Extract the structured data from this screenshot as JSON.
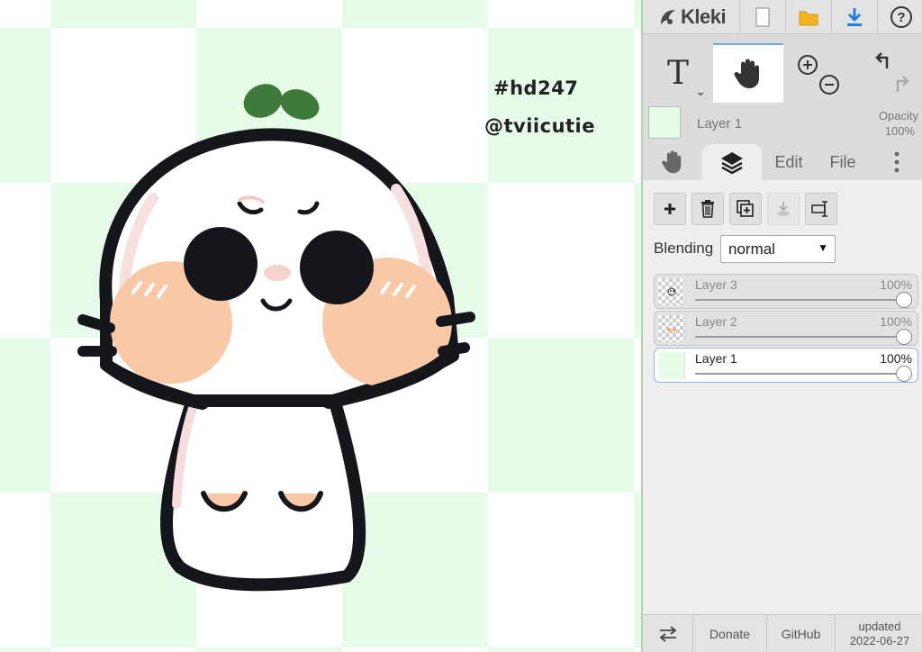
{
  "canvas": {
    "watermark_line1": "#hd247",
    "watermark_line2": "@tviicutie",
    "colors": {
      "checker_green": "#e6fbe8",
      "outline": "#14161c",
      "cheek": "#f9c9a7",
      "leaf": "#3f7a3a",
      "nose": "#f4d3cf"
    }
  },
  "topbar": {
    "app_name": "Kleki",
    "icons": [
      "kleki-logo-icon",
      "new-document-icon",
      "open-folder-icon",
      "download-icon",
      "help-icon"
    ]
  },
  "tools": {
    "text_tool_glyph": "T",
    "caret": "⌄",
    "active_tool": "hand-tool",
    "icons": [
      "text-tool-icon",
      "hand-tool-icon",
      "zoom-in-icon",
      "zoom-out-icon",
      "undo-icon",
      "redo-icon"
    ]
  },
  "layer_info": {
    "name": "Layer 1",
    "opacity_label": "Opacity",
    "opacity_value": "100%"
  },
  "tabs": {
    "edit": "Edit",
    "file": "File",
    "active": "layers"
  },
  "layer_panel": {
    "action_icons": [
      "add-layer-icon",
      "delete-layer-icon",
      "duplicate-layer-icon",
      "merge-down-icon",
      "rename-layer-icon"
    ],
    "blending_label": "Blending",
    "blending_value": "normal",
    "layers": [
      {
        "name": "Layer 3",
        "opacity": "100%",
        "opacity_fraction": 1.0,
        "selected": false
      },
      {
        "name": "Layer 2",
        "opacity": "100%",
        "opacity_fraction": 1.0,
        "selected": false
      },
      {
        "name": "Layer 1",
        "opacity": "100%",
        "opacity_fraction": 1.0,
        "selected": true
      }
    ]
  },
  "bottombar": {
    "donate": "Donate",
    "github": "GitHub",
    "updated_label": "updated",
    "updated_date": "2022-06-27"
  }
}
